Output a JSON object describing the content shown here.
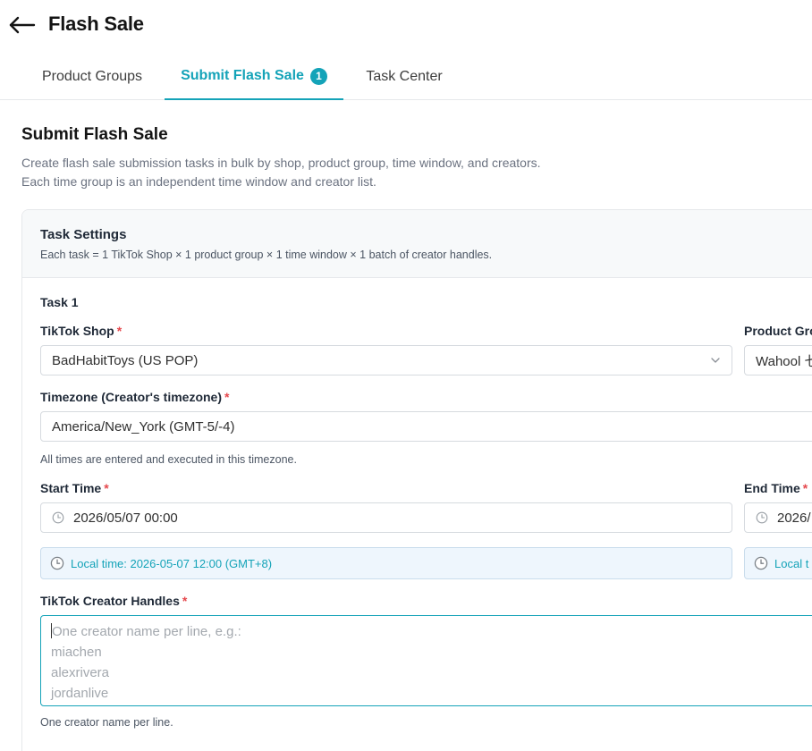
{
  "header": {
    "title": "Flash Sale",
    "back_icon": "arrow-left-icon"
  },
  "tabs": [
    {
      "label": "Product Groups",
      "active": false
    },
    {
      "label": "Submit Flash Sale",
      "active": true,
      "badge": "1"
    },
    {
      "label": "Task Center",
      "active": false
    }
  ],
  "section": {
    "title": "Submit Flash Sale",
    "description": "Create flash sale submission tasks in bulk by shop, product group, time window, and creators. Each time group is an independent time window and creator list."
  },
  "card": {
    "title": "Task Settings",
    "subtitle": "Each task = 1 TikTok Shop × 1 product group × 1 time window × 1 batch of creator handles."
  },
  "task": {
    "label": "Task 1",
    "shop": {
      "label": "TikTok Shop",
      "required": "*",
      "value": "BadHabitToys (US POP)"
    },
    "product_group": {
      "label": "Product Gro",
      "value": "Wahool 七"
    },
    "timezone": {
      "label": "Timezone (Creator's timezone)",
      "required": "*",
      "value": "America/New_York (GMT-5/-4)",
      "help": "All times are entered and executed in this timezone."
    },
    "start_time": {
      "label": "Start Time",
      "required": "*",
      "value": "2026/05/07 00:00",
      "local": "Local time: 2026-05-07 12:00 (GMT+8)"
    },
    "end_time": {
      "label": "End Time",
      "required": "*",
      "value": "2026/",
      "local": "Local t"
    },
    "creators": {
      "label": "TikTok Creator Handles",
      "required": "*",
      "placeholder_lines": [
        "One creator name per line, e.g.:",
        "miachen",
        "alexrivera",
        "jordanlive"
      ],
      "help": "One creator name per line."
    }
  },
  "colors": {
    "accent": "#14a3b8",
    "required": "#e5484d",
    "local_bg": "#eef6fd"
  }
}
